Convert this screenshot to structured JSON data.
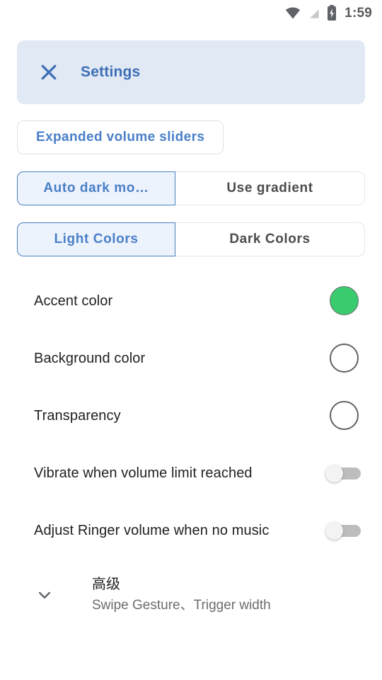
{
  "status_bar": {
    "icons": [
      "wifi-icon",
      "signal-off-icon",
      "battery-charging-icon"
    ],
    "time": "1:59"
  },
  "header": {
    "close_icon": "close-icon",
    "title": "Settings",
    "background_color": "#E1E9F5",
    "title_color": "#3D6FB5"
  },
  "buttons": {
    "expanded_volume_sliders": "Expanded volume sliders"
  },
  "segmented_controls": [
    {
      "name": "dark-mode-gradient",
      "options": [
        {
          "label": "Auto dark mo…",
          "selected": true
        },
        {
          "label": "Use gradient",
          "selected": false
        }
      ]
    },
    {
      "name": "color-scheme",
      "options": [
        {
          "label": "Light Colors",
          "selected": true
        },
        {
          "label": "Dark Colors",
          "selected": false
        }
      ]
    }
  ],
  "settings_rows": [
    {
      "label": "Accent color",
      "control": "color-swatch",
      "value": "#3ACB6E",
      "filled": true
    },
    {
      "label": "Background color",
      "control": "color-swatch",
      "value": "#FFFFFF",
      "filled": false
    },
    {
      "label": "Transparency",
      "control": "color-swatch",
      "value": "#FFFFFF",
      "filled": false
    },
    {
      "label": "Vibrate when volume limit reached",
      "control": "toggle",
      "value": "off"
    },
    {
      "label": "Adjust Ringer volume when no music",
      "control": "toggle",
      "value": "off"
    }
  ],
  "advanced": {
    "chevron_icon": "chevron-down-icon",
    "title": "高级",
    "subtitle": "Swipe Gesture、Trigger width"
  },
  "colors": {
    "accent": "#3ACB6E",
    "brand_blue": "#4A7FC8",
    "header_blue": "#E1E9F5",
    "toggle_track": "#BDBDBD"
  }
}
